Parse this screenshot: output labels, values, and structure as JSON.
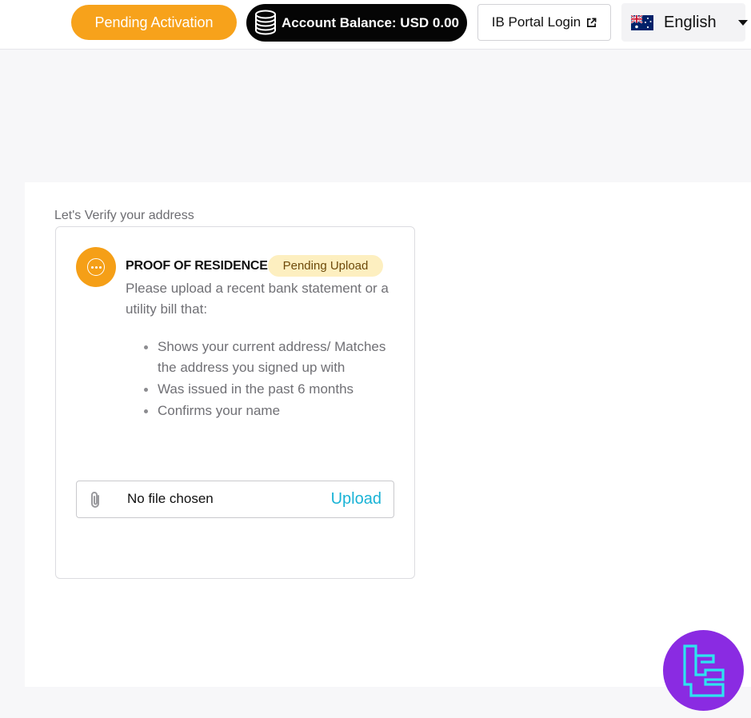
{
  "header": {
    "status_pill": "Pending Activation",
    "balance": "Account Balance: USD 0.00",
    "ib_login": "IB Portal Login",
    "language": "English"
  },
  "main": {
    "section_title": "Let's Verify your address",
    "card": {
      "title": "PROOF OF RESIDENCE",
      "badge": "Pending Upload",
      "description": "Please upload a recent bank statement or a utility bill that:",
      "requirements": [
        "Shows your current address/ Matches the address you signed up with",
        "Was issued in the past 6 months",
        "Confirms your name"
      ],
      "file_status": "No file chosen",
      "upload_label": "Upload"
    }
  },
  "colors": {
    "accent_orange": "#f7a21b",
    "badge_bg": "#fdefc0",
    "upload_link": "#19b3d6",
    "balance_bg": "#050505"
  },
  "icons": [
    "coins-icon",
    "external-link-icon",
    "australia-flag-icon",
    "caret-down-icon",
    "more-dots-icon",
    "paperclip-icon",
    "brand-logo-icon"
  ]
}
